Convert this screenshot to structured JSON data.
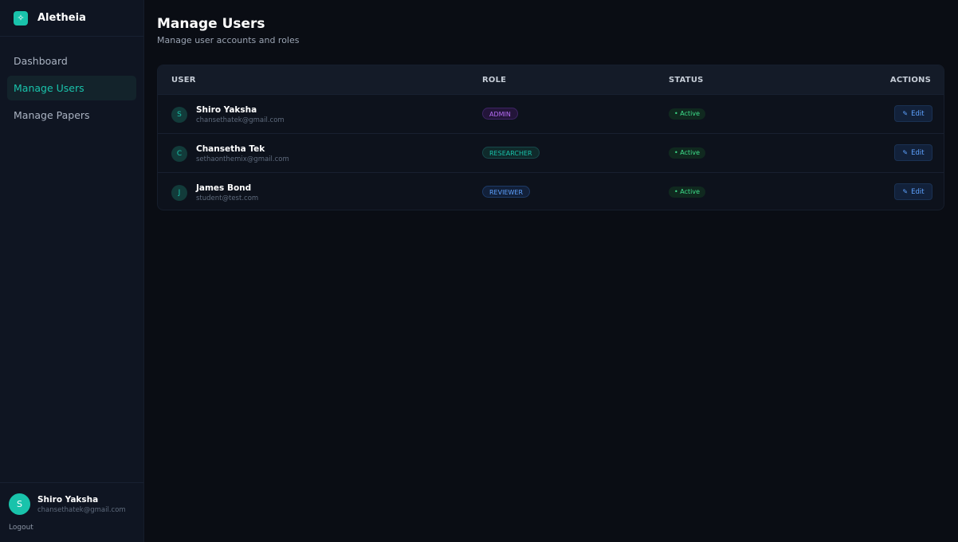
{
  "sidebar": {
    "brand": "Aletheia",
    "nav": [
      {
        "label": "Dashboard"
      },
      {
        "label": "Manage Users"
      },
      {
        "label": "Manage Papers"
      }
    ],
    "footer": {
      "avatar_initial": "S",
      "name": "Shiro Yaksha",
      "email": "chansethatek@gmail.com",
      "logout_label": "Logout"
    }
  },
  "header": {
    "title": "Manage Users",
    "subtitle": "Manage user accounts and roles"
  },
  "table": {
    "columns": [
      "USER",
      "ROLE",
      "STATUS",
      "ACTIONS"
    ],
    "rows": [
      {
        "initial": "S",
        "name": "Shiro Yaksha",
        "email": "chansethatek@gmail.com",
        "role": "ADMIN",
        "status": "• Active",
        "action": "Edit"
      },
      {
        "initial": "C",
        "name": "Chansetha Tek",
        "email": "sethaonthemix@gmail.com",
        "role": "RESEARCHER",
        "status": "• Active",
        "action": "Edit"
      },
      {
        "initial": "J",
        "name": "James Bond",
        "email": "student@test.com",
        "role": "REVIEWER",
        "status": "• Active",
        "action": "Edit"
      }
    ]
  },
  "colors": {
    "accent": "#19c3ab",
    "background": "#0a0d14",
    "sidebar": "#0f1522",
    "admin": "#b56cf5",
    "researcher": "#19c3ab",
    "reviewer": "#5ea2ff",
    "active": "#3ee08c"
  }
}
